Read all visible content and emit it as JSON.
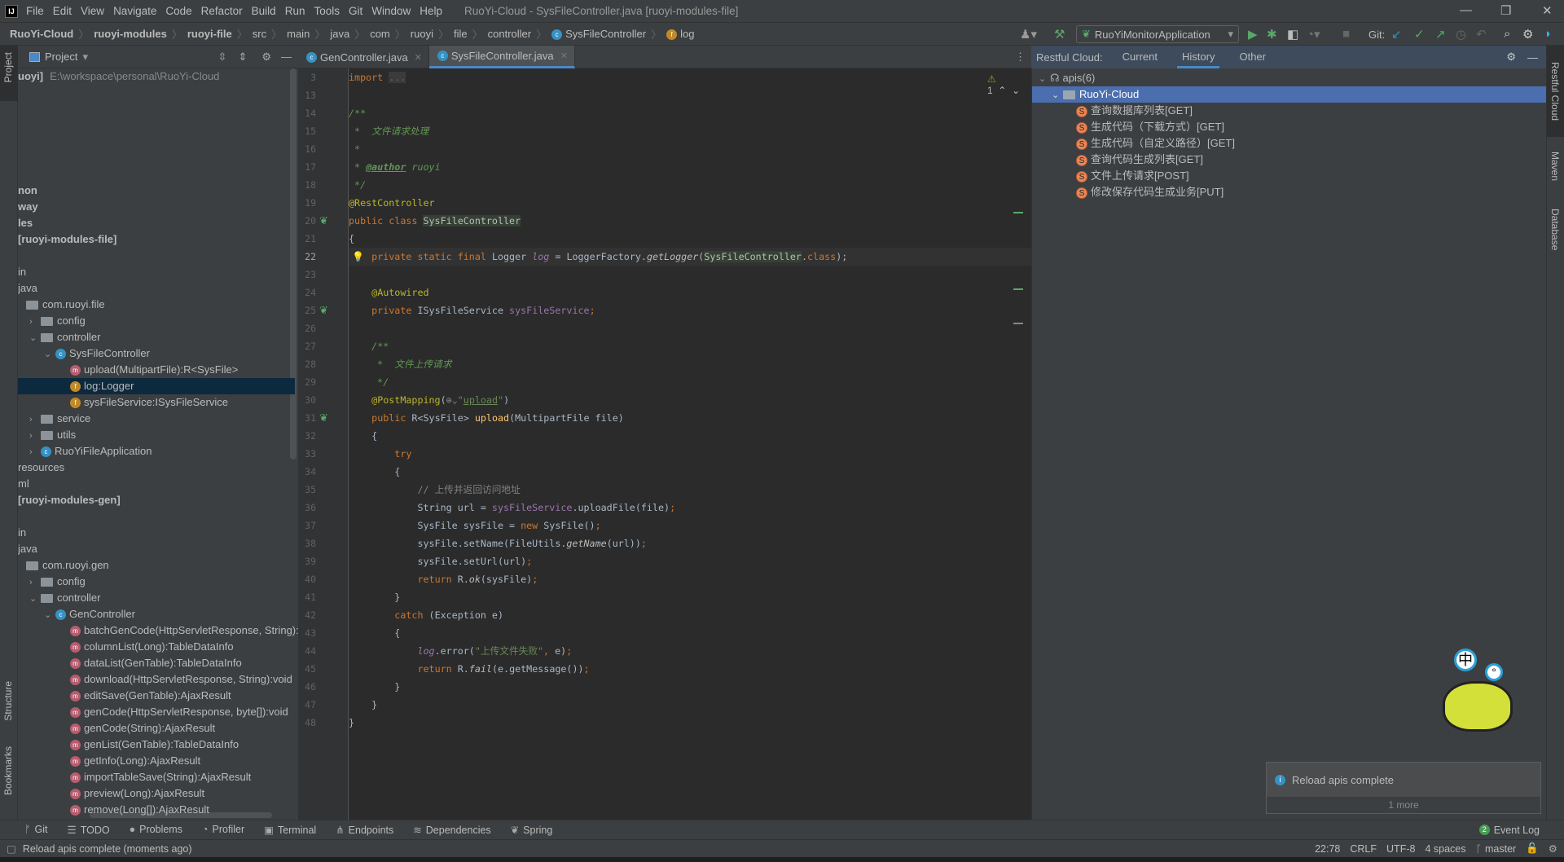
{
  "menu": {
    "items": [
      "File",
      "Edit",
      "View",
      "Navigate",
      "Code",
      "Refactor",
      "Build",
      "Run",
      "Tools",
      "Git",
      "Window",
      "Help"
    ],
    "title": "RuoYi-Cloud - SysFileController.java [ruoyi-modules-file]",
    "logo": "IJ"
  },
  "breadcrumb": [
    {
      "t": "RuoYi-Cloud",
      "b": true
    },
    {
      "t": "ruoyi-modules",
      "b": true
    },
    {
      "t": "ruoyi-file",
      "b": true
    },
    {
      "t": "src"
    },
    {
      "t": "main"
    },
    {
      "t": "java"
    },
    {
      "t": "com"
    },
    {
      "t": "ruoyi"
    },
    {
      "t": "file"
    },
    {
      "t": "controller"
    },
    {
      "t": "SysFileController",
      "icon": "class"
    },
    {
      "t": "log",
      "icon": "field"
    }
  ],
  "toolbar": {
    "run_config": "RuoYiMonitorApplication",
    "git_label": "Git:"
  },
  "project": {
    "title": "Project",
    "rows": [
      {
        "k": 0,
        "t": "uoyi]",
        "b": true,
        "extra": "E:\\workspace\\personal\\RuoYi-Cloud"
      },
      {
        "k": 7,
        "t": "non",
        "b": true
      },
      {
        "k": 8,
        "t": "way",
        "b": true
      },
      {
        "k": 9,
        "t": "les",
        "b": true
      },
      {
        "k": 10,
        "t": " [ruoyi-modules-file]",
        "b": true
      },
      {
        "k": 12,
        "t": "in"
      },
      {
        "k": 13,
        "t": "java"
      },
      {
        "k": 14,
        "t": "com.ruoyi.file",
        "icon": "folder",
        "ind": 0
      },
      {
        "k": 15,
        "t": "config",
        "icon": "folder",
        "ind": 1,
        "arrow": "›"
      },
      {
        "k": 16,
        "t": "controller",
        "icon": "folder",
        "ind": 1,
        "arrow": "⌄"
      },
      {
        "k": 17,
        "t": "SysFileController",
        "icon": "class",
        "ind": 2,
        "arrow": "⌄"
      },
      {
        "k": 18,
        "t": "upload(MultipartFile):R<SysFile>",
        "icon": "method",
        "ind": 3
      },
      {
        "k": 19,
        "t": "log:Logger",
        "icon": "field",
        "ind": 3,
        "sel": true
      },
      {
        "k": 20,
        "t": "sysFileService:ISysFileService",
        "icon": "field",
        "ind": 3
      },
      {
        "k": 21,
        "t": "service",
        "icon": "folder",
        "ind": 1,
        "arrow": "›"
      },
      {
        "k": 22,
        "t": "utils",
        "icon": "folder",
        "ind": 1,
        "arrow": "›"
      },
      {
        "k": 23,
        "t": "RuoYiFileApplication",
        "icon": "class",
        "ind": 1,
        "arrow": "›"
      },
      {
        "k": 24,
        "t": "resources"
      },
      {
        "k": 25,
        "t": "ml"
      },
      {
        "k": 26,
        "t": " [ruoyi-modules-gen]",
        "b": true
      },
      {
        "k": 28,
        "t": "in"
      },
      {
        "k": 29,
        "t": "java"
      },
      {
        "k": 30,
        "t": "com.ruoyi.gen",
        "icon": "folder",
        "ind": 0
      },
      {
        "k": 31,
        "t": "config",
        "icon": "folder",
        "ind": 1,
        "arrow": "›"
      },
      {
        "k": 32,
        "t": "controller",
        "icon": "folder",
        "ind": 1,
        "arrow": "⌄"
      },
      {
        "k": 33,
        "t": "GenController",
        "icon": "class",
        "ind": 2,
        "arrow": "⌄"
      },
      {
        "k": 34,
        "t": "batchGenCode(HttpServletResponse, String):void",
        "icon": "method",
        "ind": 3
      },
      {
        "k": 35,
        "t": "columnList(Long):TableDataInfo",
        "icon": "method",
        "ind": 3
      },
      {
        "k": 36,
        "t": "dataList(GenTable):TableDataInfo",
        "icon": "method",
        "ind": 3
      },
      {
        "k": 37,
        "t": "download(HttpServletResponse, String):void",
        "icon": "method",
        "ind": 3
      },
      {
        "k": 38,
        "t": "editSave(GenTable):AjaxResult",
        "icon": "method",
        "ind": 3
      },
      {
        "k": 39,
        "t": "genCode(HttpServletResponse, byte[]):void",
        "icon": "method",
        "ind": 3
      },
      {
        "k": 40,
        "t": "genCode(String):AjaxResult",
        "icon": "method",
        "ind": 3
      },
      {
        "k": 41,
        "t": "genList(GenTable):TableDataInfo",
        "icon": "method",
        "ind": 3
      },
      {
        "k": 42,
        "t": "getInfo(Long):AjaxResult",
        "icon": "method",
        "ind": 3
      },
      {
        "k": 43,
        "t": "importTableSave(String):AjaxResult",
        "icon": "method",
        "ind": 3
      },
      {
        "k": 44,
        "t": "preview(Long):AjaxResult",
        "icon": "method",
        "ind": 3
      },
      {
        "k": 45,
        "t": "remove(Long[]):AjaxResult",
        "icon": "method",
        "ind": 3
      }
    ]
  },
  "left_strip": {
    "project": "Project",
    "structure": "Structure",
    "bookmarks": "Bookmarks"
  },
  "right_strip": {
    "restful": "Restful Cloud",
    "maven": "Maven",
    "database": "Database"
  },
  "editor": {
    "tabs": [
      {
        "label": "GenController.java",
        "active": false
      },
      {
        "label": "SysFileController.java",
        "active": true
      }
    ],
    "warnings": "1",
    "current_line": 22,
    "lines": [
      {
        "n": 3,
        "tk": [
          [
            "kw",
            "import"
          ],
          [
            "df",
            " "
          ],
          [
            "fold",
            "..."
          ]
        ]
      },
      {
        "n": 13,
        "tk": []
      },
      {
        "n": 14,
        "tk": [
          [
            "cm",
            "/**"
          ]
        ]
      },
      {
        "n": 15,
        "tk": [
          [
            "cm",
            " *  文件请求处理"
          ]
        ]
      },
      {
        "n": 16,
        "tk": [
          [
            "cm",
            " *"
          ]
        ]
      },
      {
        "n": 17,
        "tk": [
          [
            "cm",
            " * "
          ],
          [
            "tag",
            "@author"
          ],
          [
            "cm",
            " ruoyi"
          ]
        ]
      },
      {
        "n": 18,
        "tk": [
          [
            "cm",
            " */"
          ]
        ]
      },
      {
        "n": 19,
        "tk": [
          [
            "an",
            "@RestController"
          ]
        ]
      },
      {
        "n": 20,
        "tk": [
          [
            "kw",
            "public class "
          ],
          [
            "hl",
            "SysFileController"
          ]
        ]
      },
      {
        "n": 21,
        "tk": [
          [
            "df",
            "{"
          ]
        ]
      },
      {
        "n": 22,
        "tk": [
          [
            "df",
            "    "
          ],
          [
            "kw",
            "private static final "
          ],
          [
            "df",
            "Logger "
          ],
          [
            "fdi",
            "log"
          ],
          [
            "df",
            " = LoggerFactory."
          ],
          [
            "it",
            "getLogger"
          ],
          [
            "df",
            "("
          ],
          [
            "hl",
            "SysFileController"
          ],
          [
            "df",
            "."
          ],
          [
            "kw",
            "class"
          ],
          [
            "df",
            ");"
          ]
        ]
      },
      {
        "n": 23,
        "tk": []
      },
      {
        "n": 24,
        "tk": [
          [
            "df",
            "    "
          ],
          [
            "an",
            "@Autowired"
          ]
        ]
      },
      {
        "n": 25,
        "tk": [
          [
            "df",
            "    "
          ],
          [
            "kw",
            "private "
          ],
          [
            "df",
            "ISysFileService "
          ],
          [
            "fd",
            "sysFileService"
          ],
          [
            "kw",
            ";"
          ]
        ]
      },
      {
        "n": 26,
        "tk": []
      },
      {
        "n": 27,
        "tk": [
          [
            "df",
            "    "
          ],
          [
            "cm",
            "/**"
          ]
        ]
      },
      {
        "n": 28,
        "tk": [
          [
            "cm",
            "     *  文件上传请求"
          ]
        ]
      },
      {
        "n": 29,
        "tk": [
          [
            "cm",
            "     */"
          ]
        ]
      },
      {
        "n": 30,
        "tk": [
          [
            "df",
            "    "
          ],
          [
            "an",
            "@PostMapping"
          ],
          [
            "df",
            "("
          ],
          [
            "cmt",
            "⊕⌄"
          ],
          [
            "st",
            "\""
          ],
          [
            "st und",
            "upload"
          ],
          [
            "st",
            "\""
          ],
          [
            "df",
            ")"
          ]
        ]
      },
      {
        "n": 31,
        "tk": [
          [
            "df",
            "    "
          ],
          [
            "kw",
            "public "
          ],
          [
            "df",
            "R<SysFile> "
          ],
          [
            "fn",
            "upload"
          ],
          [
            "df",
            "(MultipartFile file)"
          ]
        ]
      },
      {
        "n": 32,
        "tk": [
          [
            "df",
            "    {"
          ]
        ]
      },
      {
        "n": 33,
        "tk": [
          [
            "df",
            "        "
          ],
          [
            "kw",
            "try"
          ]
        ]
      },
      {
        "n": 34,
        "tk": [
          [
            "df",
            "        {"
          ]
        ]
      },
      {
        "n": 35,
        "tk": [
          [
            "df",
            "            "
          ],
          [
            "cmt",
            "// 上传并返回访问地址"
          ]
        ]
      },
      {
        "n": 36,
        "tk": [
          [
            "df",
            "            String url = "
          ],
          [
            "fd",
            "sysFileService"
          ],
          [
            "df",
            ".uploadFile(file)"
          ],
          [
            "kw",
            ";"
          ]
        ]
      },
      {
        "n": 37,
        "tk": [
          [
            "df",
            "            SysFile sysFile = "
          ],
          [
            "kw",
            "new "
          ],
          [
            "df",
            "SysFile()"
          ],
          [
            "kw",
            ";"
          ]
        ]
      },
      {
        "n": 38,
        "tk": [
          [
            "df",
            "            sysFile.setName(FileUtils."
          ],
          [
            "it",
            "getName"
          ],
          [
            "df",
            "(url))"
          ],
          [
            "kw",
            ";"
          ]
        ]
      },
      {
        "n": 39,
        "tk": [
          [
            "df",
            "            sysFile.setUrl(url)"
          ],
          [
            "kw",
            ";"
          ]
        ]
      },
      {
        "n": 40,
        "tk": [
          [
            "df",
            "            "
          ],
          [
            "kw",
            "return "
          ],
          [
            "df",
            "R."
          ],
          [
            "it",
            "ok"
          ],
          [
            "df",
            "(sysFile)"
          ],
          [
            "kw",
            ";"
          ]
        ]
      },
      {
        "n": 41,
        "tk": [
          [
            "df",
            "        }"
          ]
        ]
      },
      {
        "n": 42,
        "tk": [
          [
            "df",
            "        "
          ],
          [
            "kw",
            "catch "
          ],
          [
            "df",
            "(Exception e)"
          ]
        ]
      },
      {
        "n": 43,
        "tk": [
          [
            "df",
            "        {"
          ]
        ]
      },
      {
        "n": 44,
        "tk": [
          [
            "df",
            "            "
          ],
          [
            "fdi",
            "log"
          ],
          [
            "df",
            ".error("
          ],
          [
            "st",
            "\"上传文件失败\""
          ],
          [
            "kw",
            ", "
          ],
          [
            "df",
            "e)"
          ],
          [
            "kw",
            ";"
          ]
        ]
      },
      {
        "n": 45,
        "tk": [
          [
            "df",
            "            "
          ],
          [
            "kw",
            "return "
          ],
          [
            "df",
            "R."
          ],
          [
            "it",
            "fail"
          ],
          [
            "df",
            "(e.getMessage())"
          ],
          [
            "kw",
            ";"
          ]
        ]
      },
      {
        "n": 46,
        "tk": [
          [
            "df",
            "        }"
          ]
        ]
      },
      {
        "n": 47,
        "tk": [
          [
            "df",
            "    }"
          ]
        ]
      },
      {
        "n": 48,
        "tk": [
          [
            "df",
            "}"
          ]
        ]
      }
    ]
  },
  "restful": {
    "label": "Restful Cloud:",
    "tabs": [
      {
        "label": "Current",
        "active": false
      },
      {
        "label": "History",
        "active": true
      },
      {
        "label": "Other",
        "active": false
      }
    ],
    "root": "apis(6)",
    "project": "RuoYi-Cloud",
    "apis": [
      "查询数据库列表[GET]",
      "生成代码（下载方式）[GET]",
      "生成代码（自定义路径）[GET]",
      "查询代码生成列表[GET]",
      "文件上传请求[POST]",
      "修改保存代码生成业务[PUT]"
    ]
  },
  "notification": {
    "message": "Reload apis complete",
    "more": "1 more"
  },
  "bottom_tools": [
    {
      "icon": "ᚠ",
      "label": "Git"
    },
    {
      "icon": "☰",
      "label": "TODO"
    },
    {
      "icon": "●",
      "label": "Problems"
    },
    {
      "icon": "◔",
      "label": "Profiler"
    },
    {
      "icon": "▣",
      "label": "Terminal"
    },
    {
      "icon": "⋔",
      "label": "Endpoints"
    },
    {
      "icon": "≋",
      "label": "Dependencies"
    },
    {
      "icon": "❦",
      "label": "Spring"
    }
  ],
  "event_log": {
    "count": "2",
    "label": "Event Log"
  },
  "status": {
    "message": "Reload apis complete (moments ago)",
    "position": "22:78",
    "line_sep": "CRLF",
    "encoding": "UTF-8",
    "indent": "4 spaces",
    "branch": "master"
  },
  "colors": {
    "accent": "#4a88c7",
    "selection": "#4b6eaf",
    "editor_bg": "#2b2b2b",
    "panel_bg": "#3c3f41"
  }
}
